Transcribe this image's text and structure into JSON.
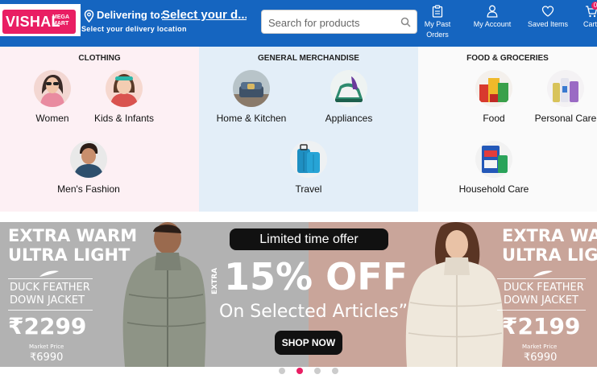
{
  "header": {
    "logo_main": "VISHAL",
    "logo_sub": "MEGA MART",
    "delivering_label": "Delivering to:",
    "delivering_link": "Select your d...",
    "delivering_sub": "Select your delivery location",
    "search_placeholder": "Search for products",
    "past_orders_line1": "My Past",
    "past_orders_line2": "Orders",
    "account": "My Account",
    "saved": "Saved Items",
    "cart": "Cart",
    "cart_count": "0",
    "colors": {
      "bar": "#1565c0",
      "brand": "#e91e63"
    }
  },
  "categories": [
    {
      "heading": "CLOTHING",
      "items": [
        {
          "label": "Women",
          "icon": "women-icon"
        },
        {
          "label": "Kids & Infants",
          "icon": "kids-icon"
        },
        {
          "label": "Men's Fashion",
          "icon": "men-icon"
        }
      ]
    },
    {
      "heading": "GENERAL MERCHANDISE",
      "items": [
        {
          "label": "Home & Kitchen",
          "icon": "home-kitchen-icon"
        },
        {
          "label": "Appliances",
          "icon": "appliances-icon"
        },
        {
          "label": "Travel",
          "icon": "travel-icon"
        }
      ]
    },
    {
      "heading": "FOOD & GROCERIES",
      "items": [
        {
          "label": "Food",
          "icon": "food-icon"
        },
        {
          "label": "Personal Care",
          "icon": "personal-care-icon"
        },
        {
          "label": "Household Care",
          "icon": "household-care-icon"
        }
      ]
    }
  ],
  "banner": {
    "left_line1": "EXTRA WARM",
    "left_line2": "ULTRA LIGHT",
    "left_product1": "DUCK FEATHER",
    "left_product2": "DOWN JACKET",
    "left_price": "₹2299",
    "left_mrp_label": "Market Price",
    "left_mrp": "₹6990",
    "offer_pill": "Limited time offer",
    "extra": "EXTRA",
    "discount": "15% OFF",
    "selected": "On Selected Articles”",
    "shop_now": "SHOP NOW",
    "right_line1": "EXTRA WARM",
    "right_line2": "ULTRA LIGHT",
    "right_product1": "DUCK FEATHER",
    "right_product2": "DOWN JACKET",
    "right_price": "₹2199",
    "right_mrp_label": "Market Price",
    "right_mrp": "₹6990"
  },
  "carousel": {
    "slides": 4,
    "active_index": 1
  }
}
